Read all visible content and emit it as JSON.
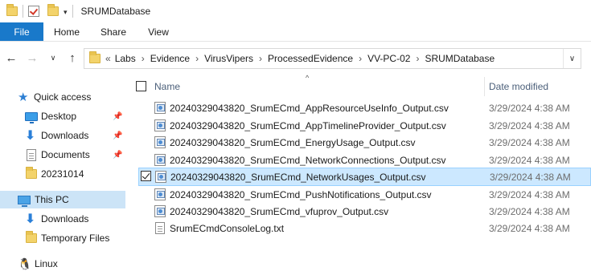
{
  "window": {
    "title": "SRUMDatabase"
  },
  "ribbon": {
    "tabs": [
      "File",
      "Home",
      "Share",
      "View"
    ]
  },
  "address": {
    "breadcrumbs": [
      "Labs",
      "Evidence",
      "VirusVipers",
      "ProcessedEvidence",
      "VV-PC-02",
      "SRUMDatabase"
    ]
  },
  "nav": {
    "quick_access": "Quick access",
    "items": [
      {
        "label": "Desktop",
        "icon": "desktop-icon",
        "pinned": true
      },
      {
        "label": "Downloads",
        "icon": "download-icon",
        "pinned": true
      },
      {
        "label": "Documents",
        "icon": "document-icon",
        "pinned": true
      },
      {
        "label": "20231014",
        "icon": "folder-icon",
        "pinned": false
      }
    ],
    "this_pc": "This PC",
    "pc_items": [
      {
        "label": "Downloads",
        "icon": "download-icon"
      },
      {
        "label": "Temporary Files",
        "icon": "folder-icon"
      }
    ],
    "linux": "Linux"
  },
  "columns": {
    "name": "Name",
    "date": "Date modified"
  },
  "files": [
    {
      "name": "20240329043820_SrumECmd_AppResourceUseInfo_Output.csv",
      "date": "3/29/2024 4:38 AM",
      "type": "csv",
      "selected": false
    },
    {
      "name": "20240329043820_SrumECmd_AppTimelineProvider_Output.csv",
      "date": "3/29/2024 4:38 AM",
      "type": "csv",
      "selected": false
    },
    {
      "name": "20240329043820_SrumECmd_EnergyUsage_Output.csv",
      "date": "3/29/2024 4:38 AM",
      "type": "csv",
      "selected": false
    },
    {
      "name": "20240329043820_SrumECmd_NetworkConnections_Output.csv",
      "date": "3/29/2024 4:38 AM",
      "type": "csv",
      "selected": false
    },
    {
      "name": "20240329043820_SrumECmd_NetworkUsages_Output.csv",
      "date": "3/29/2024 4:38 AM",
      "type": "csv",
      "selected": true
    },
    {
      "name": "20240329043820_SrumECmd_PushNotifications_Output.csv",
      "date": "3/29/2024 4:38 AM",
      "type": "csv",
      "selected": false
    },
    {
      "name": "20240329043820_SrumECmd_vfuprov_Output.csv",
      "date": "3/29/2024 4:38 AM",
      "type": "csv",
      "selected": false
    },
    {
      "name": "SrumECmdConsoleLog.txt",
      "date": "3/29/2024 4:38 AM",
      "type": "txt",
      "selected": false
    }
  ]
}
